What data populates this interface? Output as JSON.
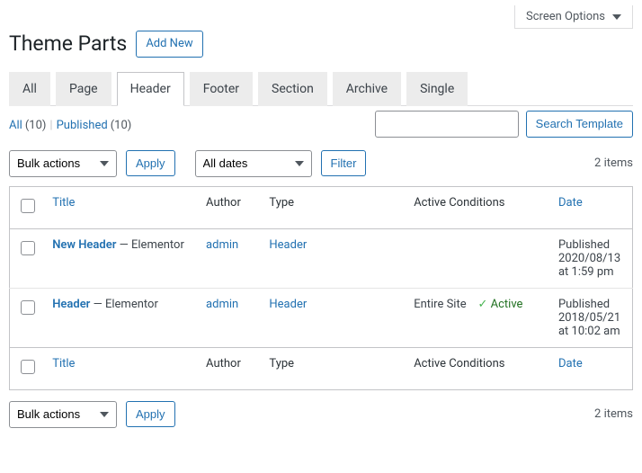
{
  "screen_options": "Screen Options",
  "page_title": "Theme Parts",
  "add_new": "Add New",
  "tabs": [
    {
      "label": "All"
    },
    {
      "label": "Page"
    },
    {
      "label": "Header"
    },
    {
      "label": "Footer"
    },
    {
      "label": "Section"
    },
    {
      "label": "Archive"
    },
    {
      "label": "Single"
    }
  ],
  "active_tab_index": 2,
  "views": {
    "all_label": "All",
    "all_count": "(10)",
    "published_label": "Published",
    "published_count": "(10)"
  },
  "search_button": "Search Template",
  "bulk_actions": "Bulk actions",
  "apply": "Apply",
  "all_dates": "All dates",
  "filter": "Filter",
  "items_count": "2 items",
  "columns": {
    "title": "Title",
    "author": "Author",
    "type": "Type",
    "conditions": "Active Conditions",
    "date": "Date"
  },
  "rows": [
    {
      "title": "New Header",
      "suffix": "— Elementor",
      "author": "admin",
      "type": "Header",
      "condition": "",
      "active": "",
      "date": "Published 2020/08/13 at 1:59 pm"
    },
    {
      "title": "Header",
      "suffix": "— Elementor",
      "author": "admin",
      "type": "Header",
      "condition": "Entire Site",
      "active": "Active",
      "date": "Published 2018/05/21 at 10:02 am"
    }
  ]
}
